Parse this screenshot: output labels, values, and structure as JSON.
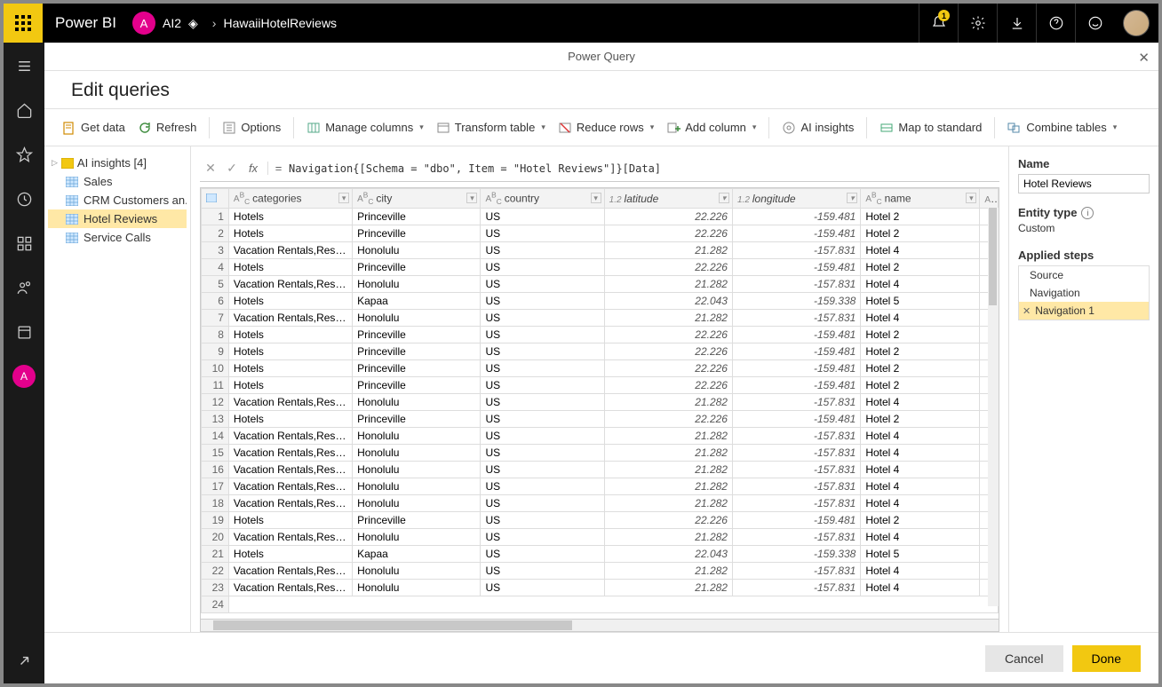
{
  "header": {
    "brand": "Power BI",
    "avatar_letter": "A",
    "crumb1": "AI2",
    "crumb2": "HawaiiHotelReviews",
    "notif_count": "1"
  },
  "pq": {
    "center_title": "Power Query",
    "title": "Edit queries"
  },
  "ribbon": {
    "get_data": "Get data",
    "refresh": "Refresh",
    "options": "Options",
    "manage_columns": "Manage columns",
    "transform_table": "Transform table",
    "reduce_rows": "Reduce rows",
    "add_column": "Add column",
    "ai_insights": "AI insights",
    "map_standard": "Map to standard",
    "combine_tables": "Combine tables"
  },
  "queries": {
    "folder": "AI insights  [4]",
    "items": [
      "Sales",
      "CRM Customers an...",
      "Hotel Reviews",
      "Service Calls"
    ],
    "selected_index": 2
  },
  "formula": "Navigation{[Schema = \"dbo\", Item = \"Hotel Reviews\"]}[Data]",
  "columns": [
    "categories",
    "city",
    "country",
    "latitude",
    "longitude",
    "name"
  ],
  "rows": [
    {
      "n": 1,
      "cat": "Hotels",
      "city": "Princeville",
      "country": "US",
      "lat": "22.226",
      "lon": "-159.481",
      "name": "Hotel 2"
    },
    {
      "n": 2,
      "cat": "Hotels",
      "city": "Princeville",
      "country": "US",
      "lat": "22.226",
      "lon": "-159.481",
      "name": "Hotel 2"
    },
    {
      "n": 3,
      "cat": "Vacation Rentals,Resorts &...",
      "city": "Honolulu",
      "country": "US",
      "lat": "21.282",
      "lon": "-157.831",
      "name": "Hotel 4"
    },
    {
      "n": 4,
      "cat": "Hotels",
      "city": "Princeville",
      "country": "US",
      "lat": "22.226",
      "lon": "-159.481",
      "name": "Hotel 2"
    },
    {
      "n": 5,
      "cat": "Vacation Rentals,Resorts &...",
      "city": "Honolulu",
      "country": "US",
      "lat": "21.282",
      "lon": "-157.831",
      "name": "Hotel 4"
    },
    {
      "n": 6,
      "cat": "Hotels",
      "city": "Kapaa",
      "country": "US",
      "lat": "22.043",
      "lon": "-159.338",
      "name": "Hotel 5"
    },
    {
      "n": 7,
      "cat": "Vacation Rentals,Resorts &...",
      "city": "Honolulu",
      "country": "US",
      "lat": "21.282",
      "lon": "-157.831",
      "name": "Hotel 4"
    },
    {
      "n": 8,
      "cat": "Hotels",
      "city": "Princeville",
      "country": "US",
      "lat": "22.226",
      "lon": "-159.481",
      "name": "Hotel 2"
    },
    {
      "n": 9,
      "cat": "Hotels",
      "city": "Princeville",
      "country": "US",
      "lat": "22.226",
      "lon": "-159.481",
      "name": "Hotel 2"
    },
    {
      "n": 10,
      "cat": "Hotels",
      "city": "Princeville",
      "country": "US",
      "lat": "22.226",
      "lon": "-159.481",
      "name": "Hotel 2"
    },
    {
      "n": 11,
      "cat": "Hotels",
      "city": "Princeville",
      "country": "US",
      "lat": "22.226",
      "lon": "-159.481",
      "name": "Hotel 2"
    },
    {
      "n": 12,
      "cat": "Vacation Rentals,Resorts &...",
      "city": "Honolulu",
      "country": "US",
      "lat": "21.282",
      "lon": "-157.831",
      "name": "Hotel 4"
    },
    {
      "n": 13,
      "cat": "Hotels",
      "city": "Princeville",
      "country": "US",
      "lat": "22.226",
      "lon": "-159.481",
      "name": "Hotel 2"
    },
    {
      "n": 14,
      "cat": "Vacation Rentals,Resorts &...",
      "city": "Honolulu",
      "country": "US",
      "lat": "21.282",
      "lon": "-157.831",
      "name": "Hotel 4"
    },
    {
      "n": 15,
      "cat": "Vacation Rentals,Resorts &...",
      "city": "Honolulu",
      "country": "US",
      "lat": "21.282",
      "lon": "-157.831",
      "name": "Hotel 4"
    },
    {
      "n": 16,
      "cat": "Vacation Rentals,Resorts &...",
      "city": "Honolulu",
      "country": "US",
      "lat": "21.282",
      "lon": "-157.831",
      "name": "Hotel 4"
    },
    {
      "n": 17,
      "cat": "Vacation Rentals,Resorts &...",
      "city": "Honolulu",
      "country": "US",
      "lat": "21.282",
      "lon": "-157.831",
      "name": "Hotel 4"
    },
    {
      "n": 18,
      "cat": "Vacation Rentals,Resorts &...",
      "city": "Honolulu",
      "country": "US",
      "lat": "21.282",
      "lon": "-157.831",
      "name": "Hotel 4"
    },
    {
      "n": 19,
      "cat": "Hotels",
      "city": "Princeville",
      "country": "US",
      "lat": "22.226",
      "lon": "-159.481",
      "name": "Hotel 2"
    },
    {
      "n": 20,
      "cat": "Vacation Rentals,Resorts &...",
      "city": "Honolulu",
      "country": "US",
      "lat": "21.282",
      "lon": "-157.831",
      "name": "Hotel 4"
    },
    {
      "n": 21,
      "cat": "Hotels",
      "city": "Kapaa",
      "country": "US",
      "lat": "22.043",
      "lon": "-159.338",
      "name": "Hotel 5"
    },
    {
      "n": 22,
      "cat": "Vacation Rentals,Resorts &...",
      "city": "Honolulu",
      "country": "US",
      "lat": "21.282",
      "lon": "-157.831",
      "name": "Hotel 4"
    },
    {
      "n": 23,
      "cat": "Vacation Rentals,Resorts &...",
      "city": "Honolulu",
      "country": "US",
      "lat": "21.282",
      "lon": "-157.831",
      "name": "Hotel 4"
    }
  ],
  "right": {
    "name_label": "Name",
    "name_value": "Hotel Reviews",
    "entity_label": "Entity type",
    "entity_value": "Custom",
    "steps_label": "Applied steps",
    "steps": [
      "Source",
      "Navigation",
      "Navigation 1"
    ],
    "steps_selected": 2
  },
  "footer": {
    "cancel": "Cancel",
    "done": "Done"
  }
}
